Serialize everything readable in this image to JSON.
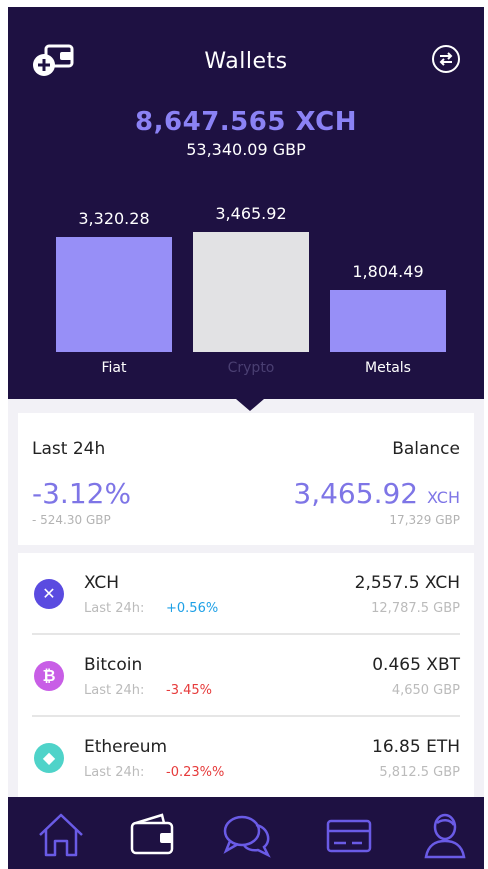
{
  "header": {
    "title": "Wallets",
    "total_xch": "8,647.565 XCH",
    "total_gbp": "53,340.09 GBP"
  },
  "chart_data": {
    "type": "bar",
    "categories": [
      "Fiat",
      "Crypto",
      "Metals"
    ],
    "values": [
      3320.28,
      3465.92,
      1804.49
    ],
    "value_labels": [
      "3,320.28",
      "3,465.92",
      "1,804.49"
    ],
    "selected": "Crypto",
    "colors": {
      "bar": "#978ff7",
      "selected_bar": "#e2e2e4",
      "label": "#ffffff",
      "selected_label": "#4a3f72"
    }
  },
  "summary": {
    "last24_label": "Last 24h",
    "balance_label": "Balance",
    "change_pct": "-3.12%",
    "change_gbp": "- 524.30 GBP",
    "balance_value": "3,465.92",
    "balance_unit": "XCH",
    "balance_gbp": "17,329 GBP"
  },
  "assets": [
    {
      "name": "XCH",
      "icon": "xch-icon",
      "glyph": "✕",
      "icon_color": "#5a4be0",
      "last24_label": "Last 24h:",
      "change": "+0.56%",
      "change_color": "#1ea0e6",
      "amount": "2,557.5 XCH",
      "fiat": "12,787.5 GBP"
    },
    {
      "name": "Bitcoin",
      "icon": "bitcoin-icon",
      "glyph": "₿",
      "icon_color": "#c85ee6",
      "last24_label": "Last 24h:",
      "change": "-3.45%",
      "change_color": "#e63b3b",
      "amount": "0.465 XBT",
      "fiat": "4,650 GBP"
    },
    {
      "name": "Ethereum",
      "icon": "ethereum-icon",
      "glyph": "◆",
      "icon_color": "#4fd3c9",
      "last24_label": "Last 24h:",
      "change": "-0.23%%",
      "change_color": "#e63b3b",
      "amount": "16.85 ETH",
      "fiat": "5,812.5 GBP"
    }
  ],
  "nav": {
    "items": [
      "home-icon",
      "wallet-icon",
      "chat-icon",
      "card-icon",
      "profile-icon"
    ],
    "active": "wallet-icon",
    "colors": {
      "inactive": "#6a5be6",
      "active": "#ffffff"
    }
  }
}
